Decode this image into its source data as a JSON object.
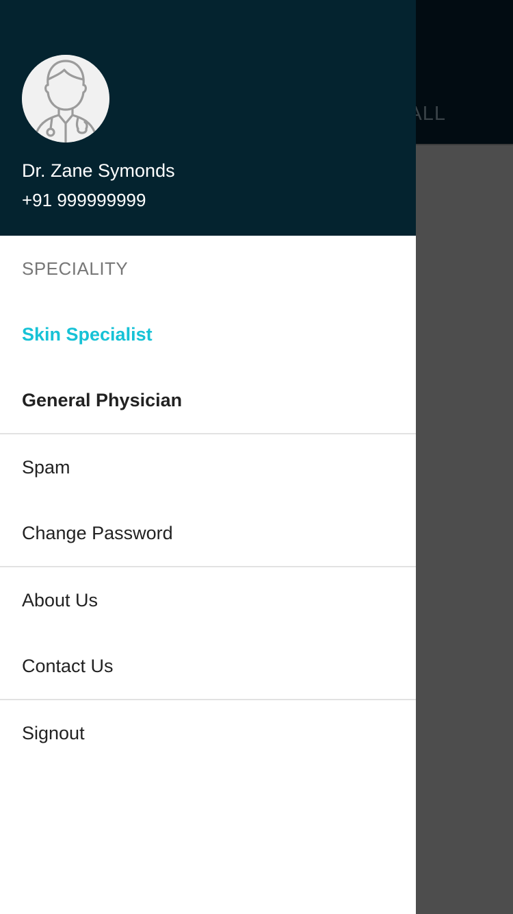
{
  "background": {
    "tab_label": "ALL"
  },
  "drawer": {
    "profile": {
      "avatar_icon": "doctor-avatar-icon",
      "name": "Dr. Zane Symonds",
      "phone": "+91 999999999"
    },
    "speciality": {
      "title": "SPECIALITY",
      "items": [
        {
          "label": "Skin Specialist",
          "active": true
        },
        {
          "label": "General Physician",
          "active": false
        }
      ]
    },
    "menu": {
      "spam": "Spam",
      "change_password": "Change Password",
      "about_us": "About Us",
      "contact_us": "Contact Us",
      "signout": "Signout"
    }
  },
  "colors": {
    "header_bg": "#04232f",
    "accent": "#17c2d6",
    "overlay": "#4d4d4d"
  }
}
